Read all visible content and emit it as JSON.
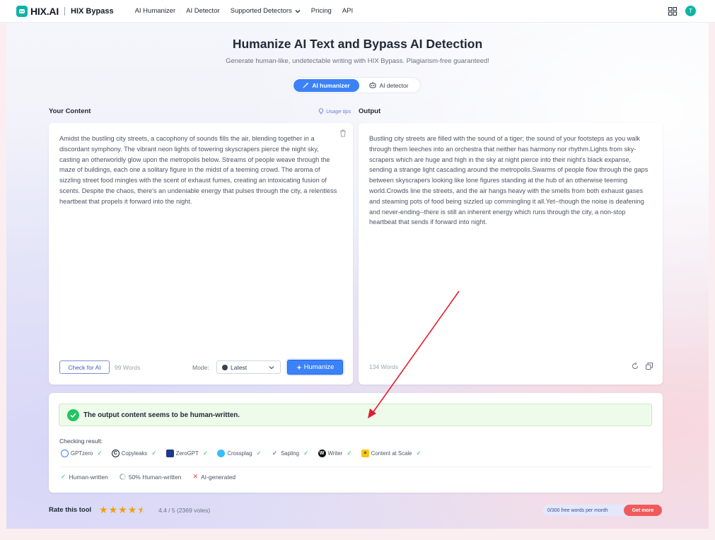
{
  "nav": {
    "brand": "HIX.AI",
    "product": "HIX Bypass",
    "links": [
      "AI Humanizer",
      "AI Detector",
      "Supported Detectors",
      "Pricing",
      "API"
    ],
    "avatar_initial": "T"
  },
  "hero": {
    "title": "Humanize AI Text and Bypass AI Detection",
    "subtitle": "Generate human-like, undetectable writing with HIX Bypass. Plagiarism-free guaranteed!"
  },
  "toggle": {
    "active": "AI humanizer",
    "inactive": "AI detector"
  },
  "input": {
    "label": "Your Content",
    "usage_tips": "Usage tips",
    "text": "Amidst the bustling city streets, a cacophony of sounds fills the air, blending together in a discordant symphony. The vibrant neon lights of towering skyscrapers pierce the night sky, casting an otherworldly glow upon the metropolis below. Streams of people weave through the maze of buildings, each one a solitary figure in the midst of a teeming crowd. The aroma of sizzling street food mingles with the scent of exhaust fumes, creating an intoxicating fusion of scents. Despite the chaos, there's an undeniable energy that pulses through the city, a relentless heartbeat that propels it forward into the night.",
    "check_button": "Check for AI",
    "word_count": "99 Words",
    "mode_label": "Mode:",
    "mode_value": "Latest",
    "humanize_button": "Humanize"
  },
  "output": {
    "label": "Output",
    "text": "Bustling city streets are filled with the sound of a tiger; the sound of your footsteps as you walk through them leeches into an orchestra that neither has harmony nor rhythm.Lights from sky-scrapers which are huge and high in the sky at night pierce into their night's black expanse, sending a strange light cascading around the metropolis.Swarms of people flow through the gaps between skyscrapers looking like lone figures standing at the hub of an otherwise teeming world.Crowds line the streets, and the air hangs heavy with the smells from both exhaust gases and steaming pots of food being sizzled up commingling it all.Yet--though the noise is deafening and never-ending--there is still an inherent energy which runs through the city, a non-stop heartbeat that sends if forward into night.",
    "word_count": "134 Words"
  },
  "result": {
    "banner": "The output content seems to be human-written.",
    "checking_label": "Checking result:",
    "detectors": [
      {
        "name": "GPTzero",
        "color": "#3b82f6"
      },
      {
        "name": "Copyleaks",
        "color": "#111827"
      },
      {
        "name": "ZeroGPT",
        "color": "#1e3a8a"
      },
      {
        "name": "Crossplag",
        "color": "#38bdf8"
      },
      {
        "name": "Sapling",
        "color": "#1e40af"
      },
      {
        "name": "Writer",
        "color": "#111111"
      },
      {
        "name": "Content at Scale",
        "color": "#f5c518"
      }
    ],
    "legend": [
      "Human-written",
      "50% Human-written",
      "AI-generated"
    ]
  },
  "footer": {
    "rate_label": "Rate this tool",
    "rating_text": "4.4 / 5 (2369 votes)",
    "rating": 4.4,
    "quota": "0/300 free words per month",
    "get_more": "Get more"
  },
  "colors": {
    "accent": "#3b82f6",
    "brand": "#10b3a6",
    "success": "#22c55e",
    "danger": "#f05a5a"
  }
}
